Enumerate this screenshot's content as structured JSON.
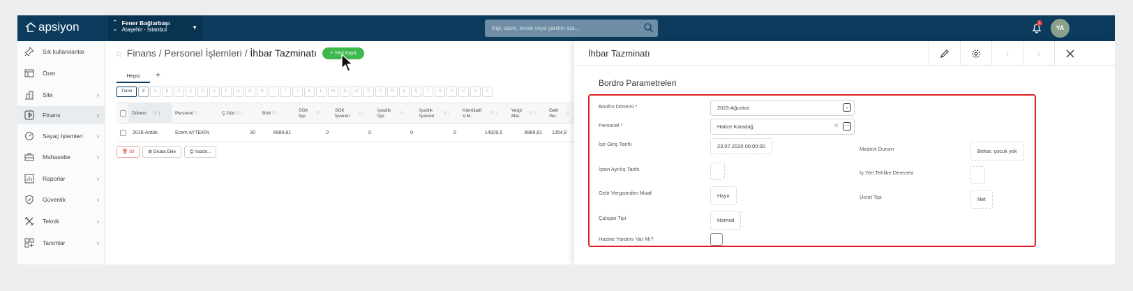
{
  "app": {
    "logo": "apsiyon"
  },
  "branch": {
    "name": "Fener Bağlarbaşı",
    "location": "Ataşehir - İstanbul"
  },
  "search": {
    "placeholder": "Kişi, daire, evrak veya yardım ara..."
  },
  "notifications": {
    "count": "1"
  },
  "user": {
    "initials": "YA"
  },
  "sidebar": {
    "items": [
      {
        "label": "Sık kullanılanlar",
        "icon": "pin-icon",
        "chevron": false
      },
      {
        "label": "Özet",
        "icon": "summary-icon",
        "chevron": false
      },
      {
        "label": "Site",
        "icon": "building-icon",
        "chevron": true
      },
      {
        "label": "Finans",
        "icon": "finance-icon",
        "chevron": true,
        "active": true
      },
      {
        "label": "Sayaç İşlemleri",
        "icon": "meter-icon",
        "chevron": true
      },
      {
        "label": "Muhasebe",
        "icon": "briefcase-icon",
        "chevron": true
      },
      {
        "label": "Raporlar",
        "icon": "report-icon",
        "chevron": true
      },
      {
        "label": "Güvenlik",
        "icon": "shield-icon",
        "chevron": true
      },
      {
        "label": "Teknik",
        "icon": "tools-icon",
        "chevron": true
      },
      {
        "label": "Tanımlar",
        "icon": "definitions-icon",
        "chevron": true
      }
    ]
  },
  "breadcrumb": {
    "part1": "Finans",
    "sep": "/",
    "part2": "Personel İşlemleri",
    "current": "İhbar Tazminatı"
  },
  "new_record": {
    "label": "Yeni Kayıt"
  },
  "tabs": {
    "active": "Hepsi",
    "add": "+"
  },
  "alphabet": {
    "all": "Tümü",
    "hash": "#",
    "letters": [
      "A",
      "B",
      "C",
      "Ç",
      "D",
      "E",
      "F",
      "G",
      "Ğ",
      "H",
      "I",
      "İ",
      "J",
      "K",
      "L",
      "M",
      "N",
      "O",
      "Ö",
      "P",
      "R",
      "S",
      "Ş",
      "T",
      "U",
      "Ü",
      "V",
      "Y",
      "Z"
    ]
  },
  "table": {
    "headers": {
      "donem": "Dönem",
      "personel": "Personel",
      "cgun": "Ç.Gün",
      "brut": "Brüt",
      "sgk_isci": "SGK İşçi",
      "sgk_isveren": "SGK İşveren",
      "issizlik_isci": "İşsizlik İşçi",
      "issizlik_isveren": "İşsizlik İşveren",
      "kumulatif": "Kümülatif V.M.",
      "vergi": "Vergi Mat.",
      "gelir": "Gelir Ver."
    },
    "row": {
      "donem": "2018-Aralık",
      "personel": "Ecem AYTEKİN",
      "cgun": "30",
      "brut": "8989,81",
      "sgk_isci": "0",
      "sgk_isveren": "0",
      "issizlik_isci": "0",
      "issizlik_isveren": "0",
      "kumulatif": "14929,5",
      "vergi": "8989,81",
      "gelir": "1354,8"
    }
  },
  "actions": {
    "delete": "Sil",
    "group": "Gruba Ekle",
    "print": "Yazdır..."
  },
  "panel": {
    "title": "İhbar Tazminatı",
    "section": "Bordro Parametreleri",
    "fields": {
      "bordro_donemi": {
        "label": "Bordro Dönemi",
        "value": "2023-Ağustos"
      },
      "personel": {
        "label": "Personel",
        "value": "Hatice Karadağ"
      },
      "ise_giris": {
        "label": "İşe Giriş Tarihi",
        "value": "23.07.2020 00:00:00"
      },
      "medeni": {
        "label": "Medeni Durum",
        "value": "Bekar, çocuk yok"
      },
      "isten_ayrilis": {
        "label": "İşten Ayrılış Tarihi",
        "value": ""
      },
      "tehlike": {
        "label": "İş Yeri Tehlike Derecesi",
        "value": ""
      },
      "gelir_muaf": {
        "label": "Gelir Vergisinden Muaf",
        "value": "Hayır"
      },
      "ucret_tipi": {
        "label": "Ücret Tipi",
        "value": "Net"
      },
      "calisan_tipi": {
        "label": "Çalışan Tipi",
        "value": "Normal"
      },
      "hazine": {
        "label": "Hazine Yardımı Var Mı?"
      }
    },
    "required_mark": "*"
  }
}
